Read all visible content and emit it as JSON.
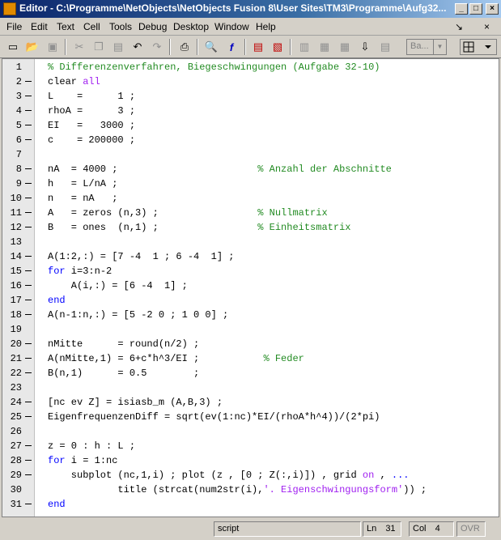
{
  "window": {
    "title": "Editor - C:\\Programme\\NetObjects\\NetObjects Fusion 8\\User Sites\\TM3\\Programme\\Aufg32...",
    "min": "_",
    "max": "□",
    "close": "×"
  },
  "menu": {
    "items": [
      "File",
      "Edit",
      "Text",
      "Cell",
      "Tools",
      "Debug",
      "Desktop",
      "Window",
      "Help"
    ],
    "right": [
      "↘",
      "×"
    ]
  },
  "toolbar": {
    "combo": "Ba...",
    "icons": [
      "new-file-icon",
      "open-folder-icon",
      "save-icon",
      "cut-icon",
      "copy-icon",
      "paste-icon",
      "undo-icon",
      "redo-icon",
      "print-icon",
      "find-icon",
      "function-icon",
      "cell-icon",
      "clear-breakpoints-icon",
      "step-icon",
      "step-in-icon",
      "step-out-icon",
      "continue-icon",
      "exit-debug-icon",
      "grid-layout-icon"
    ]
  },
  "code": [
    {
      "n": "1",
      "bp": false,
      "segs": [
        {
          "t": "% Differenzenverfahren, Biegeschwingungen (Aufgabe 32-10)",
          "c": "comment"
        }
      ]
    },
    {
      "n": "2",
      "bp": true,
      "segs": [
        {
          "t": "clear "
        },
        {
          "t": "all",
          "c": "str"
        }
      ]
    },
    {
      "n": "3",
      "bp": true,
      "segs": [
        {
          "t": "L    =      1 ;"
        }
      ]
    },
    {
      "n": "4",
      "bp": true,
      "segs": [
        {
          "t": "rhoA =      3 ;"
        }
      ]
    },
    {
      "n": "5",
      "bp": true,
      "segs": [
        {
          "t": "EI   =   3000 ;"
        }
      ]
    },
    {
      "n": "6",
      "bp": true,
      "segs": [
        {
          "t": "c    = 200000 ;"
        }
      ]
    },
    {
      "n": "7",
      "bp": false,
      "segs": [
        {
          "t": ""
        }
      ]
    },
    {
      "n": "8",
      "bp": true,
      "segs": [
        {
          "t": "nA  = 4000 ;                        "
        },
        {
          "t": "% Anzahl der Abschnitte",
          "c": "comment"
        }
      ]
    },
    {
      "n": "9",
      "bp": true,
      "segs": [
        {
          "t": "h   = L/nA ;"
        }
      ]
    },
    {
      "n": "10",
      "bp": true,
      "segs": [
        {
          "t": "n   = nA   ;"
        }
      ]
    },
    {
      "n": "11",
      "bp": true,
      "segs": [
        {
          "t": "A   = zeros (n,3) ;                 "
        },
        {
          "t": "% Nullmatrix",
          "c": "comment"
        }
      ]
    },
    {
      "n": "12",
      "bp": true,
      "segs": [
        {
          "t": "B   = ones  (n,1) ;                 "
        },
        {
          "t": "% Einheitsmatrix",
          "c": "comment"
        }
      ]
    },
    {
      "n": "13",
      "bp": false,
      "segs": [
        {
          "t": ""
        }
      ]
    },
    {
      "n": "14",
      "bp": true,
      "segs": [
        {
          "t": "A(1:2,:) = [7 -4  1 ; 6 -4  1] ;"
        }
      ]
    },
    {
      "n": "15",
      "bp": true,
      "segs": [
        {
          "t": "for",
          "c": "kw"
        },
        {
          "t": " i=3:n-2"
        }
      ]
    },
    {
      "n": "16",
      "bp": true,
      "segs": [
        {
          "t": "    A(i,:) = [6 -4  1] ;"
        }
      ]
    },
    {
      "n": "17",
      "bp": true,
      "segs": [
        {
          "t": "end",
          "c": "kw"
        }
      ]
    },
    {
      "n": "18",
      "bp": true,
      "segs": [
        {
          "t": "A(n-1:n,:) = [5 -2 0 ; 1 0 0] ;"
        }
      ]
    },
    {
      "n": "19",
      "bp": false,
      "segs": [
        {
          "t": ""
        }
      ]
    },
    {
      "n": "20",
      "bp": true,
      "segs": [
        {
          "t": "nMitte      = round(n/2) ;"
        }
      ]
    },
    {
      "n": "21",
      "bp": true,
      "segs": [
        {
          "t": "A(nMitte,1) = 6+c*h^3/EI ;           "
        },
        {
          "t": "% Feder",
          "c": "comment"
        }
      ]
    },
    {
      "n": "22",
      "bp": true,
      "segs": [
        {
          "t": "B(n,1)      = 0.5        ;"
        }
      ]
    },
    {
      "n": "23",
      "bp": false,
      "segs": [
        {
          "t": ""
        }
      ]
    },
    {
      "n": "24",
      "bp": true,
      "segs": [
        {
          "t": "[nc ev Z] = isiasb_m (A,B,3) ;"
        }
      ]
    },
    {
      "n": "25",
      "bp": true,
      "segs": [
        {
          "t": "EigenfrequenzenDiff = sqrt(ev(1:nc)*EI/(rhoA*h^4))/(2*pi)"
        }
      ]
    },
    {
      "n": "26",
      "bp": false,
      "segs": [
        {
          "t": ""
        }
      ]
    },
    {
      "n": "27",
      "bp": true,
      "segs": [
        {
          "t": "z = 0 : h : L ;"
        }
      ]
    },
    {
      "n": "28",
      "bp": true,
      "segs": [
        {
          "t": "for",
          "c": "kw"
        },
        {
          "t": " i = 1:nc"
        }
      ]
    },
    {
      "n": "29",
      "bp": true,
      "segs": [
        {
          "t": "    subplot (nc,1,i) ; plot (z , [0 ; Z(:,i)]) , grid "
        },
        {
          "t": "on",
          "c": "str"
        },
        {
          "t": " , "
        },
        {
          "t": "...",
          "c": "kw"
        }
      ]
    },
    {
      "n": "30",
      "bp": false,
      "segs": [
        {
          "t": "            title (strcat(num2str(i),"
        },
        {
          "t": "'. Eigenschwingungsform'",
          "c": "str"
        },
        {
          "t": ")) ;"
        }
      ]
    },
    {
      "n": "31",
      "bp": true,
      "segs": [
        {
          "t": "end",
          "c": "kw"
        }
      ]
    }
  ],
  "status": {
    "mode": "script",
    "ln_label": "Ln",
    "ln": "31",
    "col_label": "Col",
    "col": "4",
    "ovr": "OVR"
  }
}
